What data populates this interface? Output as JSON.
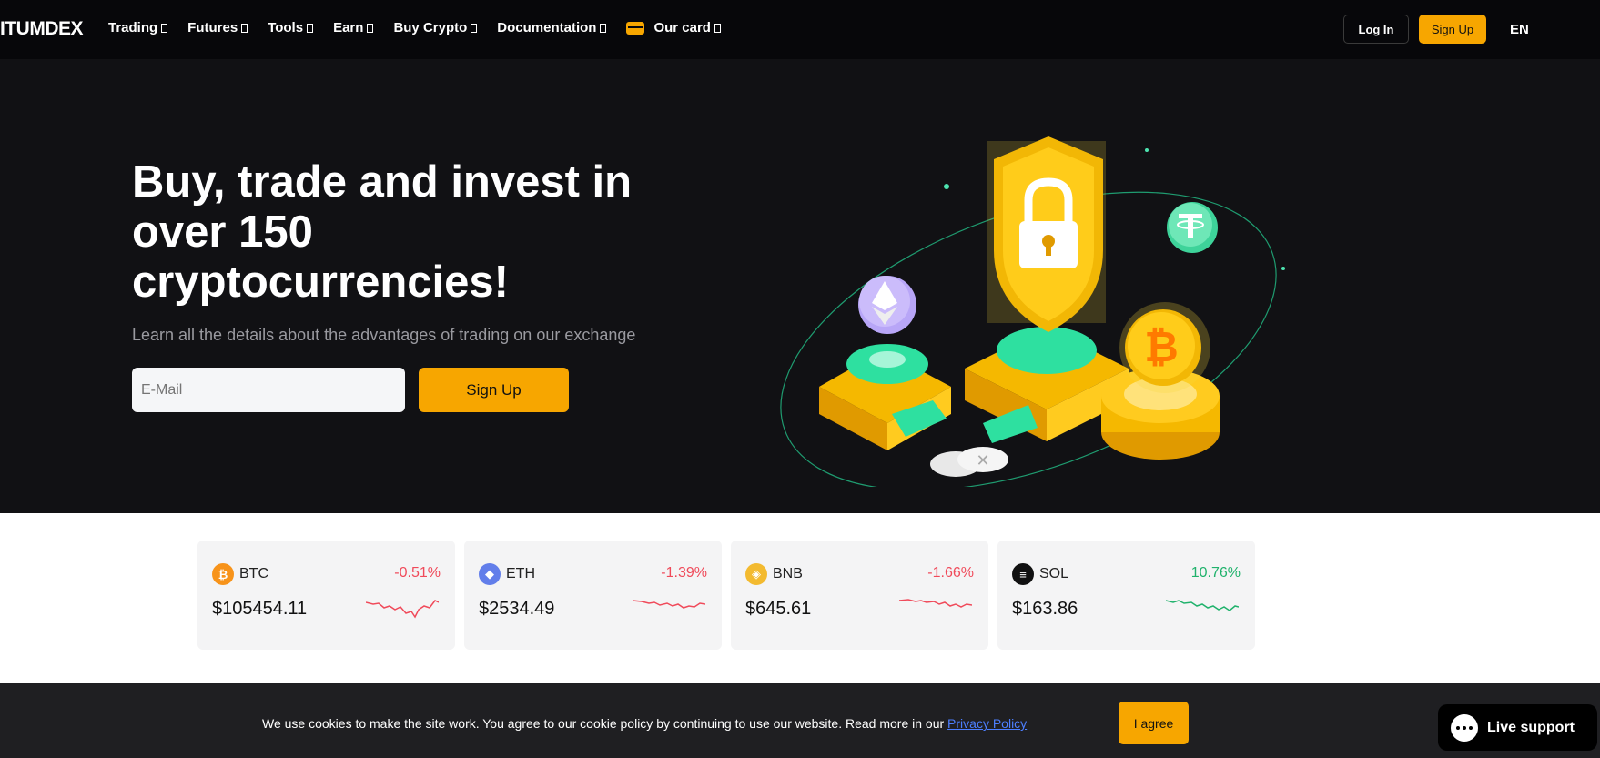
{
  "nav": {
    "logo": "ITUMDEX",
    "items": [
      {
        "label": "Trading"
      },
      {
        "label": "Futures"
      },
      {
        "label": "Tools"
      },
      {
        "label": "Earn"
      },
      {
        "label": "Buy Crypto"
      },
      {
        "label": "Documentation"
      },
      {
        "label": "Our card"
      }
    ],
    "login_label": "Log In",
    "signup_label": "Sign Up",
    "lang": "EN"
  },
  "hero": {
    "title": "Buy, trade and invest in over 150 cryptocurrencies!",
    "subtitle": "Learn all the details about the advantages of trading on our exchange",
    "email_placeholder": "E-Mail",
    "signup_label": "Sign Up"
  },
  "tickers": [
    {
      "symbol": "BTC",
      "change": "-0.51%",
      "price": "$105454.11",
      "trend": "down",
      "color": "#f7931a",
      "icon": "btc-icon"
    },
    {
      "symbol": "ETH",
      "change": "-1.39%",
      "price": "$2534.49",
      "trend": "down",
      "color": "#627eea",
      "icon": "eth-icon"
    },
    {
      "symbol": "BNB",
      "change": "-1.66%",
      "price": "$645.61",
      "trend": "down",
      "color": "#f3ba2f",
      "icon": "bnb-icon"
    },
    {
      "symbol": "SOL",
      "change": "10.76%",
      "price": "$163.86",
      "trend": "up",
      "color": "#111111",
      "icon": "sol-icon"
    }
  ],
  "colors": {
    "accent": "#f7a600",
    "down": "#f04a5a",
    "up": "#20b26c"
  },
  "cookie": {
    "text": "We use cookies to make the site work. You agree to our cookie policy by continuing to use our website. Read more in our ",
    "link": "Privacy Policy",
    "agree_label": "I agree"
  },
  "support": {
    "label": "Live support"
  }
}
